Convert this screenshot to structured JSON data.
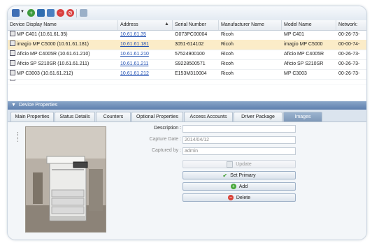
{
  "toolbar": {
    "icons": [
      "device-list-icon",
      "add-icon",
      "save-icon",
      "delete-icon",
      "remove-icon",
      "stop-icon",
      "refresh-icon"
    ]
  },
  "table": {
    "columns": [
      "Device Display Name",
      "Address",
      "Serial Number",
      "Manufacturer Name",
      "Model Name",
      "Network:"
    ],
    "rows": [
      {
        "name": "MP C401 (10.61.61.35)",
        "address": "10.61.61.35",
        "serial": "G073PC00004",
        "manufacturer": "Ricoh",
        "model": "MP C401",
        "network": "00-26-73-"
      },
      {
        "name": "imagio MP C5000 (10.61.61.181)",
        "address": "10.61.61.181",
        "serial": "3051-614102",
        "manufacturer": "Ricoh",
        "model": "imagio MP C5000",
        "network": "00-00-74-"
      },
      {
        "name": "Aficio MP C4005R (10.61.61.210)",
        "address": "10.61.61.210",
        "serial": "57524900100",
        "manufacturer": "Ricoh",
        "model": "Aficio MP C4005R",
        "network": "00-26-73-"
      },
      {
        "name": "Aficio SP S210SR (10.61.61.211)",
        "address": "10.61.61.211",
        "serial": "S9228500571",
        "manufacturer": "Ricoh",
        "model": "Aficio SP S210SR",
        "network": "00-26-73-"
      },
      {
        "name": "MP C3003 (10.61.61.212)",
        "address": "10.61.61.212",
        "serial": "E153M310004",
        "manufacturer": "Ricoh",
        "model": "MP C3003",
        "network": "00-26-73-"
      }
    ],
    "selected_index": 1
  },
  "panel": {
    "title": "Device Properties",
    "tabs": [
      "Main Properties",
      "Status Details",
      "Counters",
      "Optional Properties",
      "Access Accounts",
      "Driver Package",
      "Images"
    ],
    "active_tab": "Images"
  },
  "images": {
    "description_label": "Description :",
    "description_value": "",
    "capture_date_label": "Capture Date :",
    "capture_date_value": "2014/04/12",
    "captured_by_label": "Captured by :",
    "captured_by_value": "admin",
    "update_label": "Update",
    "set_primary_label": "Set Primary",
    "add_label": "Add",
    "delete_label": "Delete"
  },
  "colors": {
    "selected_row": "#fbecc8",
    "panel_header": "#5e7fae",
    "link": "#1f4fb3",
    "check_green": "#3a9a2c",
    "add_green": "#48a83a",
    "delete_red": "#d9443a"
  }
}
